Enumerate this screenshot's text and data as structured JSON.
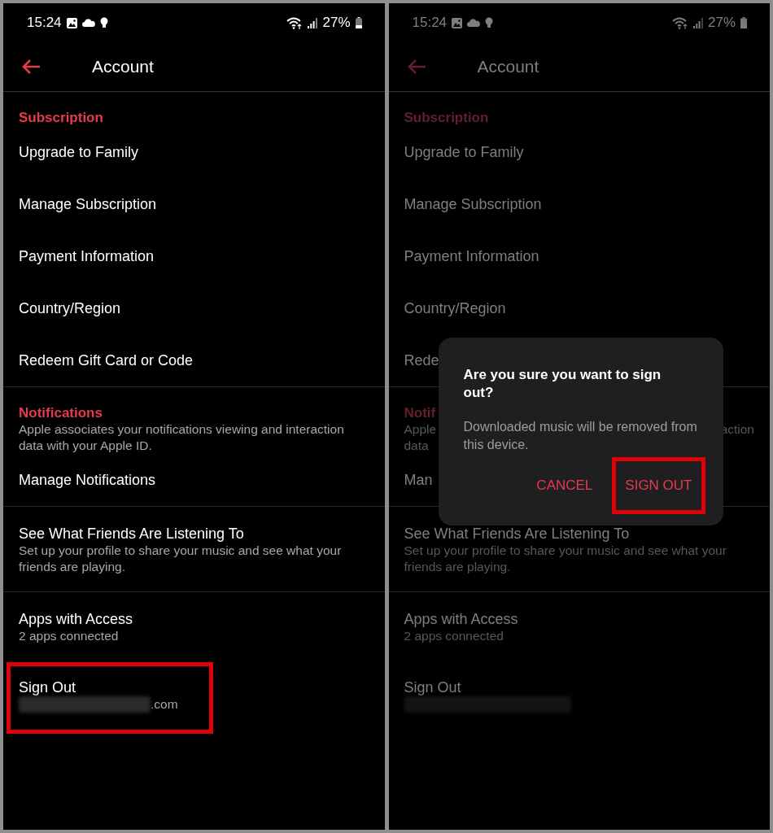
{
  "screens": [
    {
      "dimmed": false,
      "status_bar": {
        "time": "15:24",
        "battery": "27%"
      },
      "header": {
        "title": "Account"
      },
      "sections": [
        {
          "title": "Subscription",
          "items": [
            {
              "label": "Upgrade to Family"
            },
            {
              "label": "Manage Subscription"
            },
            {
              "label": "Payment Information"
            },
            {
              "label": "Country/Region"
            },
            {
              "label": "Redeem Gift Card or Code"
            }
          ]
        },
        {
          "title": "Notifications",
          "note": "Apple associates your notifications viewing and interaction data with your Apple ID.",
          "items": [
            {
              "label": "Manage Notifications"
            }
          ]
        },
        {
          "items": [
            {
              "label": "See What Friends Are Listening To",
              "detail": "Set up your profile to share your music and see what your friends are playing."
            }
          ]
        },
        {
          "items": [
            {
              "label": "Apps with Access",
              "detail": "2 apps connected"
            },
            {
              "label": "Sign Out",
              "detail": ".com",
              "redacted": true,
              "highlighted": true
            }
          ]
        }
      ]
    },
    {
      "dimmed": true,
      "status_bar": {
        "time": "15:24",
        "battery": "27%"
      },
      "header": {
        "title": "Account"
      },
      "sections": [
        {
          "title": "Subscription",
          "items": [
            {
              "label": "Upgrade to Family"
            },
            {
              "label": "Manage Subscription"
            },
            {
              "label": "Payment Information"
            },
            {
              "label": "Country/Region"
            },
            {
              "label": "Rede"
            }
          ]
        },
        {
          "title": "Notif",
          "note_lines": [
            {
              "left": "Apple",
              "right": "action"
            },
            {
              "left": "data"
            }
          ],
          "items": [
            {
              "label": "Man"
            }
          ]
        },
        {
          "items": [
            {
              "label": "See What Friends Are Listening To",
              "detail": "Set up your profile to share your music and see what your friends are playing."
            }
          ]
        },
        {
          "items": [
            {
              "label": "Apps with Access",
              "detail": "2 apps connected"
            },
            {
              "label": "Sign Out",
              "redacted": true,
              "highlighted": false
            }
          ]
        }
      ],
      "dialog": {
        "title": "Are you sure you want to sign out?",
        "message": "Downloaded music will be removed from this device.",
        "buttons": [
          {
            "label": "CANCEL",
            "highlighted": false
          },
          {
            "label": "SIGN OUT",
            "highlighted": true
          }
        ]
      }
    }
  ]
}
